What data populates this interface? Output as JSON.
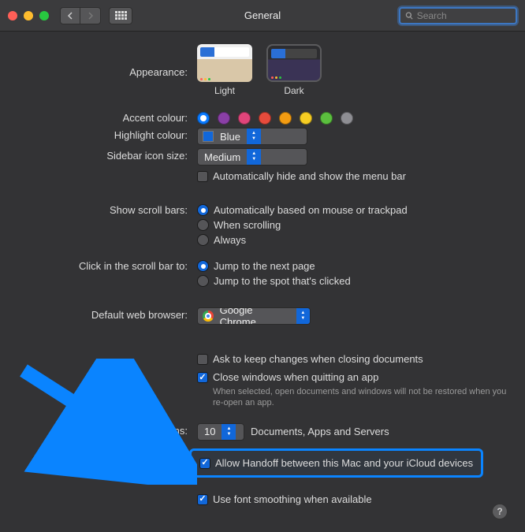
{
  "window": {
    "title": "General",
    "search_placeholder": "Search"
  },
  "appearance": {
    "label": "Appearance:",
    "light": "Light",
    "dark": "Dark",
    "selected": "Dark"
  },
  "accent": {
    "label": "Accent colour:",
    "colors": [
      "#0a7aff",
      "#8a3fa6",
      "#e0457b",
      "#e74b3c",
      "#f39c12",
      "#f6cd23",
      "#5bbf3e",
      "#8e8e93"
    ],
    "selected_index": 0
  },
  "highlight": {
    "label": "Highlight colour:",
    "value": "Blue"
  },
  "sidebar_size": {
    "label": "Sidebar icon size:",
    "value": "Medium"
  },
  "auto_hide_menu": {
    "label": "Automatically hide and show the menu bar",
    "checked": false
  },
  "scrollbars": {
    "label": "Show scroll bars:",
    "options": [
      "Automatically based on mouse or trackpad",
      "When scrolling",
      "Always"
    ],
    "selected_index": 0
  },
  "click_scroll": {
    "label": "Click in the scroll bar to:",
    "options": [
      "Jump to the next page",
      "Jump to the spot that's clicked"
    ],
    "selected_index": 0
  },
  "browser": {
    "label": "Default web browser:",
    "value": "Google Chrome"
  },
  "ask_keep": {
    "label": "Ask to keep changes when closing documents",
    "checked": false
  },
  "close_windows": {
    "label": "Close windows when quitting an app",
    "checked": true,
    "note": "When selected, open documents and windows will not be restored when you re-open an app."
  },
  "recent": {
    "label": "Recent items:",
    "value": "10",
    "suffix": "Documents, Apps and Servers"
  },
  "handoff": {
    "label": "Allow Handoff between this Mac and your iCloud devices",
    "checked": true
  },
  "font_smoothing": {
    "label": "Use font smoothing when available",
    "checked": true
  }
}
